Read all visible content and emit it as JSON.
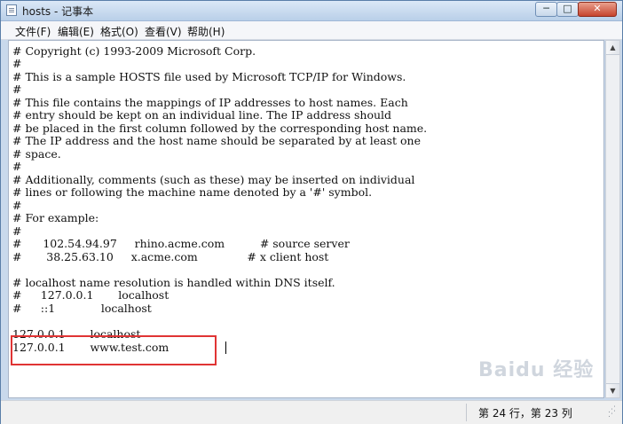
{
  "window": {
    "title": "hosts - 记事本",
    "controls": {
      "minimize": "─",
      "maximize": "□",
      "close": "✕"
    }
  },
  "menu": {
    "items": [
      "文件(F)",
      "编辑(E)",
      "格式(O)",
      "查看(V)",
      "帮助(H)"
    ]
  },
  "editor": {
    "lines": [
      "# Copyright (c) 1993-2009 Microsoft Corp.",
      "#",
      "# This is a sample HOSTS file used by Microsoft TCP/IP for Windows.",
      "#",
      "# This file contains the mappings of IP addresses to host names. Each",
      "# entry should be kept on an individual line. The IP address should",
      "# be placed in the first column followed by the corresponding host name.",
      "# The IP address and the host name should be separated by at least one",
      "# space.",
      "#",
      "# Additionally, comments (such as these) may be inserted on individual",
      "# lines or following the machine name denoted by a '#' symbol.",
      "#",
      "# For example:",
      "#",
      "#      102.54.94.97     rhino.acme.com          # source server",
      "#       38.25.63.10     x.acme.com              # x client host",
      "",
      "# localhost name resolution is handled within DNS itself.",
      "#\t127.0.0.1       localhost",
      "#\t::1             localhost",
      "",
      "127.0.0.1       localhost",
      "127.0.0.1       www.test.com"
    ]
  },
  "status": {
    "position": "第 24 行，第 23 列"
  },
  "watermark": "Baidu 经验"
}
